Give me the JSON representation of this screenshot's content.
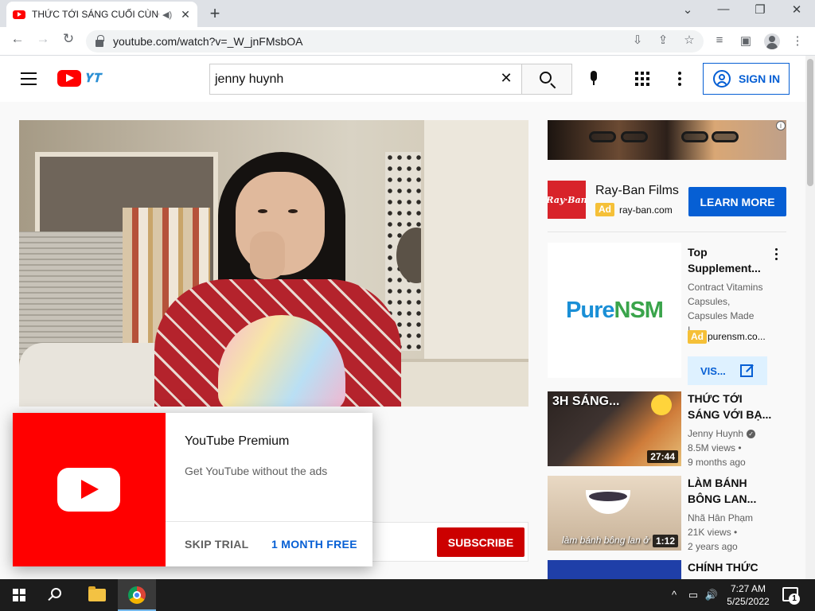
{
  "browser": {
    "tab_title": "THỨC TỚI SÁNG CUỐI CÙNG",
    "new_tab": "+",
    "window_controls": {
      "minimize": "—",
      "restore": "❐",
      "close": "✕",
      "dropdown": "⌄"
    },
    "url": "youtube.com/watch?v=_W_jnFMsbOA"
  },
  "header": {
    "logo_doodle": "𝐘𝐓",
    "search_value": "jenny huynh",
    "search_clear": "✕",
    "signin_label": "SIGN IN"
  },
  "ad": {
    "advertiser": "Ray-Ban Films",
    "badge": "Ad",
    "domain": "ray-ban.com",
    "cta": "LEARN MORE",
    "logo_text": "Ray·Ban",
    "info": "i"
  },
  "sponsored": {
    "logo_part1": "Pure",
    "logo_part2": "NSM",
    "title_line1": "Top",
    "title_line2": "Supplement...",
    "desc_line1": "Contract Vitamins",
    "desc_line2": "Capsules,",
    "desc_line3": "Capsules Made I...",
    "badge": "Ad",
    "domain": "purensm.co...",
    "cta": "VIS..."
  },
  "related": [
    {
      "thumb_text": "3H SÁNG...",
      "duration": "27:44",
      "title_line1": "THỨC TỚI",
      "title_line2": "SÁNG VỚI BẠ...",
      "channel": "Jenny Huynh",
      "views": "8.5M views •",
      "age": "9 months ago"
    },
    {
      "thumb_caption": "làm bánh bông lan ở",
      "duration": "1:12",
      "title_line1": "LÀM BÁNH",
      "title_line2": "BÔNG LAN...",
      "channel": "Nhã Hân Phạm",
      "views": "21K views •",
      "age": "2 years ago"
    },
    {
      "title_line1": "CHÍNH THỨC"
    }
  ],
  "subscribe_label": "SUBSCRIBE",
  "premium": {
    "title": "YouTube Premium",
    "subtitle": "Get YouTube without the ads",
    "skip": "SKIP TRIAL",
    "free": "1 MONTH FREE"
  },
  "taskbar": {
    "time": "7:27 AM",
    "date": "5/25/2022",
    "notifications": "1",
    "tray_chevron": "^",
    "tray_network": "▭",
    "tray_volume": "🔊"
  },
  "colors": {
    "youtube_red": "#ff0000",
    "link_blue": "#065fd4",
    "subscribe_red": "#cc0000",
    "ad_yellow": "#f5c038"
  }
}
